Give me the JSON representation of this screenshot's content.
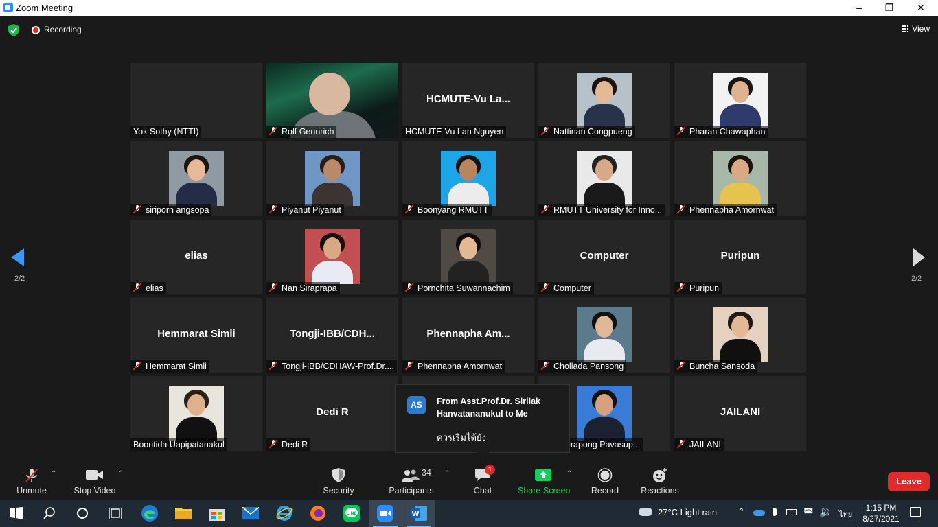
{
  "window": {
    "title": "Zoom Meeting",
    "controls": [
      "minimize-icon",
      "maximize-icon",
      "close-icon"
    ]
  },
  "meeting": {
    "recording_label": "Recording",
    "view_label": "View",
    "page_indicator": "2/2"
  },
  "tiles": [
    {
      "name": "Yok Sothy (NTTI)",
      "muted": false,
      "big_name": "",
      "kind": "blank"
    },
    {
      "name": "Rolf Gennrich",
      "muted": true,
      "big_name": "",
      "kind": "video"
    },
    {
      "name": "HCMUTE-Vu Lan Nguyen",
      "muted": false,
      "big_name": "HCMUTE-Vu  La...",
      "kind": "text"
    },
    {
      "name": "Nattinan Congpueng",
      "muted": true,
      "big_name": "",
      "kind": "photo"
    },
    {
      "name": "Pharan Chawaphan",
      "muted": true,
      "big_name": "",
      "kind": "photo"
    },
    {
      "name": "siriporn angsopa",
      "muted": true,
      "big_name": "",
      "kind": "photo"
    },
    {
      "name": "Piyanut Piyanut",
      "muted": true,
      "big_name": "",
      "kind": "photo"
    },
    {
      "name": "Boonyang RMUTT",
      "muted": true,
      "big_name": "",
      "kind": "photo"
    },
    {
      "name": "RMUTT University for Inno...",
      "muted": true,
      "big_name": "",
      "kind": "photo"
    },
    {
      "name": "Phennapha Amornwat",
      "muted": true,
      "big_name": "",
      "kind": "photo"
    },
    {
      "name": "elias",
      "muted": true,
      "big_name": "elias",
      "kind": "text"
    },
    {
      "name": "Nan Siraprapa",
      "muted": true,
      "big_name": "",
      "kind": "photo"
    },
    {
      "name": "Pornchita Suwannachim",
      "muted": true,
      "big_name": "",
      "kind": "photo"
    },
    {
      "name": "Computer",
      "muted": true,
      "big_name": "Computer",
      "kind": "text"
    },
    {
      "name": "Puripun",
      "muted": true,
      "big_name": "Puripun",
      "kind": "text"
    },
    {
      "name": "Hemmarat Simli",
      "muted": true,
      "big_name": "Hemmarat Simli",
      "kind": "text"
    },
    {
      "name": "Tongji-IBB/CDHAW-Prof.Dr....",
      "muted": true,
      "big_name": "Tongji-IBB/CDH...",
      "kind": "text"
    },
    {
      "name": "Phennapha Amornwat",
      "muted": true,
      "big_name": "Phennapha  Am...",
      "kind": "text"
    },
    {
      "name": "Chollada Pansong",
      "muted": true,
      "big_name": "",
      "kind": "photo"
    },
    {
      "name": "Buncha Sansoda",
      "muted": true,
      "big_name": "",
      "kind": "photo"
    },
    {
      "name": "Boontida Uapipatanakul",
      "muted": false,
      "big_name": "",
      "kind": "photo"
    },
    {
      "name": "Dedi R",
      "muted": true,
      "big_name": "Dedi R",
      "kind": "text"
    },
    {
      "name": "",
      "muted": false,
      "big_name": "",
      "kind": "hidden"
    },
    {
      "name": "UTT Sorapong Pavasup...",
      "muted": false,
      "big_name": "",
      "kind": "photo"
    },
    {
      "name": "JAILANI",
      "muted": true,
      "big_name": "JAILANI",
      "kind": "text"
    }
  ],
  "chat_popup": {
    "avatar_initials": "AS",
    "from": "From Asst.Prof.Dr. Sirilak Hanvatananukul to Me",
    "message": "ควรเริ่มได้ยัง"
  },
  "toolbar": {
    "unmute": "Unmute",
    "stop_video": "Stop Video",
    "security": "Security",
    "participants": "Participants",
    "participants_count": "34",
    "chat": "Chat",
    "chat_badge": "1",
    "share_screen": "Share Screen",
    "record": "Record",
    "reactions": "Reactions",
    "leave": "Leave",
    "colors": {
      "share_green": "#0fd15a",
      "leave_red": "#e02b2b",
      "recording_red": "#e02828"
    }
  },
  "taskbar": {
    "apps": [
      "windows-start-icon",
      "search-icon",
      "cortana-icon",
      "task-view-icon",
      "edge-icon",
      "file-explorer-icon",
      "microsoft-store-icon",
      "mail-icon",
      "internet-explorer-icon",
      "firefox-icon",
      "line-icon",
      "zoom-icon",
      "word-icon"
    ],
    "weather": "27°C  Light rain",
    "language": "ไทย",
    "time": "1:15 PM",
    "date": "8/27/2021"
  }
}
